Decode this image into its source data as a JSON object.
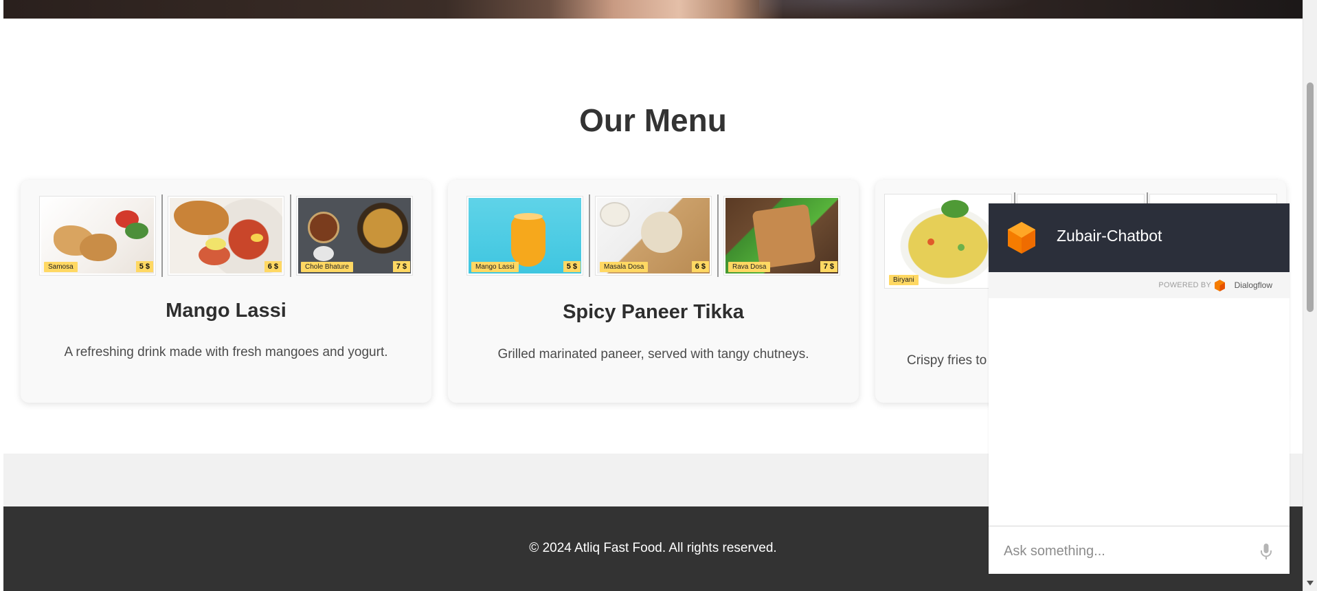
{
  "menu": {
    "title": "Our Menu",
    "cards": [
      {
        "title": "Mango Lassi",
        "description": "A refreshing drink made with fresh mangoes and yogurt.",
        "items": [
          {
            "name": "Samosa",
            "price": "5 $"
          },
          {
            "name": "",
            "price": "6 $"
          },
          {
            "name": "Chole Bhature",
            "price": "7 $"
          }
        ]
      },
      {
        "title": "Spicy Paneer Tikka",
        "description": "Grilled marinated paneer, served with tangy chutneys.",
        "items": [
          {
            "name": "Mango Lassi",
            "price": "5 $"
          },
          {
            "name": "Masala Dosa",
            "price": "6 $"
          },
          {
            "name": "Rava Dosa",
            "price": "7 $"
          }
        ]
      },
      {
        "title": "",
        "description": "Crispy fries to",
        "items": [
          {
            "name": "Biryani",
            "price": ""
          }
        ]
      }
    ]
  },
  "footer": {
    "text": "© 2024 Atliq Fast Food. All rights reserved."
  },
  "chatbot": {
    "title": "Zubair-Chatbot",
    "powered_by": "POWERED BY",
    "brand": "Dialogflow",
    "input_placeholder": "Ask something...",
    "accent_color": "#f57c00",
    "header_color": "#2b2f3a"
  }
}
